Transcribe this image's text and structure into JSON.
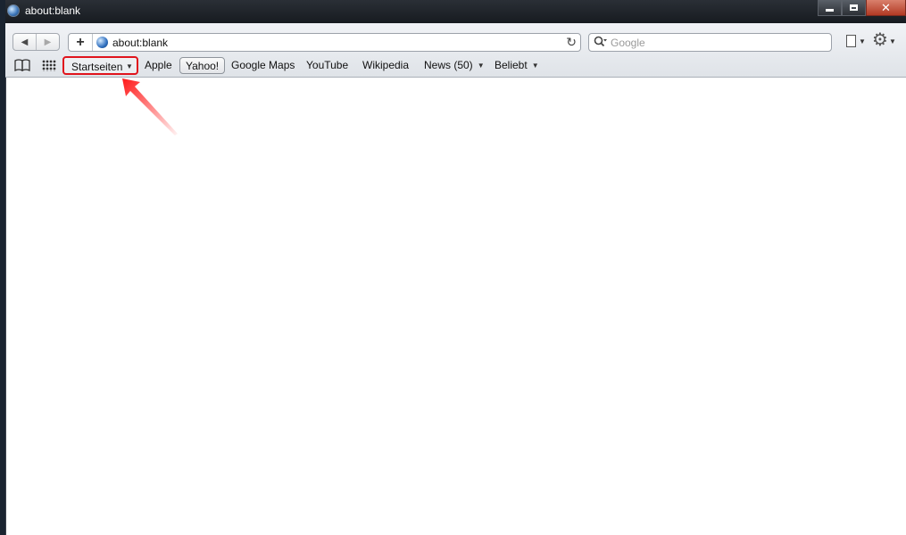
{
  "window": {
    "title": "about:blank"
  },
  "navigation": {
    "back": "◀",
    "forward": "▶"
  },
  "address_bar": {
    "add_symbol": "+",
    "url": "about:blank",
    "reload_symbol": "↻"
  },
  "search_bar": {
    "placeholder": "Google"
  },
  "bookmarks": {
    "startseiten": "Startseiten",
    "apple": "Apple",
    "yahoo": "Yahoo!",
    "google_maps": "Google Maps",
    "youtube": "YouTube",
    "wikipedia": "Wikipedia",
    "news": "News (50)",
    "beliebt": "Beliebt"
  },
  "annotation": {
    "highlight_color": "#e0141c"
  }
}
